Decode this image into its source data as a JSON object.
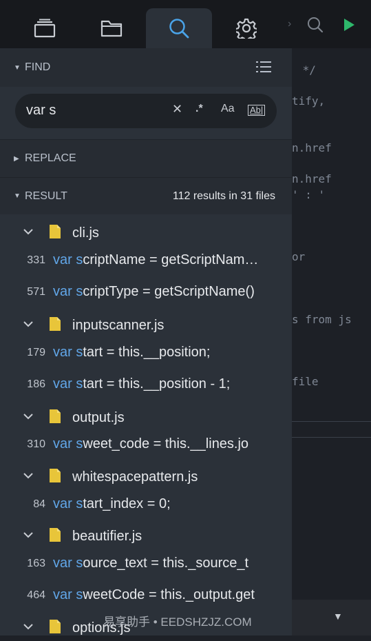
{
  "tabs": [
    {
      "name": "files",
      "icon": "stack-icon"
    },
    {
      "name": "folder",
      "icon": "folder-icon"
    },
    {
      "name": "search",
      "icon": "search-icon",
      "active": true
    },
    {
      "name": "settings",
      "icon": "gear-icon"
    }
  ],
  "editor": {
    "lines": [
      " */",
      "tify,",
      "n.href",
      "n.href",
      "' : '",
      "or",
      "s from js",
      "file"
    ]
  },
  "find": {
    "label": "FIND",
    "query": "var s",
    "clear_symbol": "✕",
    "regex_symbol": ".*",
    "case_label": "Aa",
    "word_label": "Ab|"
  },
  "replace": {
    "label": "REPLACE"
  },
  "result": {
    "label": "RESULT",
    "summary": "112 results in 31 files"
  },
  "results": [
    {
      "type": "file",
      "name": "cli.js"
    },
    {
      "type": "match",
      "line": "331",
      "kw": "var s",
      "rest": "criptName = getScriptNam…"
    },
    {
      "type": "match",
      "line": "571",
      "kw": "var s",
      "rest": "criptType = getScriptName()"
    },
    {
      "type": "file",
      "name": "inputscanner.js"
    },
    {
      "type": "match",
      "line": "179",
      "kw": "var s",
      "rest": "tart = this.__position;"
    },
    {
      "type": "match",
      "line": "186",
      "kw": "var s",
      "rest": "tart = this.__position - 1;"
    },
    {
      "type": "file",
      "name": "output.js"
    },
    {
      "type": "match",
      "line": "310",
      "kw": "var s",
      "rest": "weet_code = this.__lines.jo"
    },
    {
      "type": "file",
      "name": "whitespacepattern.js"
    },
    {
      "type": "match",
      "line": "84",
      "kw": "var s",
      "rest": "tart_index = 0;"
    },
    {
      "type": "file",
      "name": "beautifier.js"
    },
    {
      "type": "match",
      "line": "163",
      "kw": "var s",
      "rest": "ource_text = this._source_t"
    },
    {
      "type": "match",
      "line": "464",
      "kw": "var s",
      "rest": "weetCode = this._output.get"
    },
    {
      "type": "file",
      "name": "options.js"
    }
  ],
  "watermark": "易享助手 • EEDSHZJZ.COM",
  "colors": {
    "accent": "#4aa3e8",
    "keyword": "#61a6e8",
    "file_icon": "#e8c53a",
    "run": "#2eb86b"
  }
}
